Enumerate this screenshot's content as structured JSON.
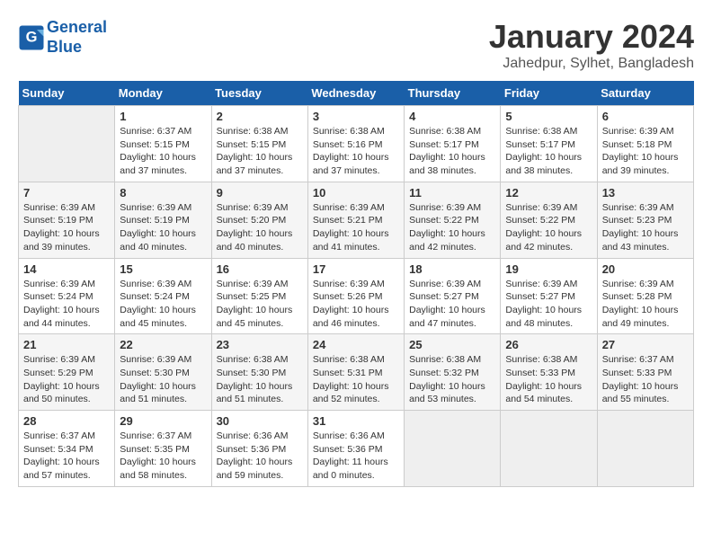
{
  "logo": {
    "line1": "General",
    "line2": "Blue"
  },
  "title": "January 2024",
  "subtitle": "Jahedpur, Sylhet, Bangladesh",
  "days_of_week": [
    "Sunday",
    "Monday",
    "Tuesday",
    "Wednesday",
    "Thursday",
    "Friday",
    "Saturday"
  ],
  "weeks": [
    [
      {
        "day": "",
        "info": ""
      },
      {
        "day": "1",
        "info": "Sunrise: 6:37 AM\nSunset: 5:15 PM\nDaylight: 10 hours\nand 37 minutes."
      },
      {
        "day": "2",
        "info": "Sunrise: 6:38 AM\nSunset: 5:15 PM\nDaylight: 10 hours\nand 37 minutes."
      },
      {
        "day": "3",
        "info": "Sunrise: 6:38 AM\nSunset: 5:16 PM\nDaylight: 10 hours\nand 37 minutes."
      },
      {
        "day": "4",
        "info": "Sunrise: 6:38 AM\nSunset: 5:17 PM\nDaylight: 10 hours\nand 38 minutes."
      },
      {
        "day": "5",
        "info": "Sunrise: 6:38 AM\nSunset: 5:17 PM\nDaylight: 10 hours\nand 38 minutes."
      },
      {
        "day": "6",
        "info": "Sunrise: 6:39 AM\nSunset: 5:18 PM\nDaylight: 10 hours\nand 39 minutes."
      }
    ],
    [
      {
        "day": "7",
        "info": "Sunrise: 6:39 AM\nSunset: 5:19 PM\nDaylight: 10 hours\nand 39 minutes."
      },
      {
        "day": "8",
        "info": "Sunrise: 6:39 AM\nSunset: 5:19 PM\nDaylight: 10 hours\nand 40 minutes."
      },
      {
        "day": "9",
        "info": "Sunrise: 6:39 AM\nSunset: 5:20 PM\nDaylight: 10 hours\nand 40 minutes."
      },
      {
        "day": "10",
        "info": "Sunrise: 6:39 AM\nSunset: 5:21 PM\nDaylight: 10 hours\nand 41 minutes."
      },
      {
        "day": "11",
        "info": "Sunrise: 6:39 AM\nSunset: 5:22 PM\nDaylight: 10 hours\nand 42 minutes."
      },
      {
        "day": "12",
        "info": "Sunrise: 6:39 AM\nSunset: 5:22 PM\nDaylight: 10 hours\nand 42 minutes."
      },
      {
        "day": "13",
        "info": "Sunrise: 6:39 AM\nSunset: 5:23 PM\nDaylight: 10 hours\nand 43 minutes."
      }
    ],
    [
      {
        "day": "14",
        "info": "Sunrise: 6:39 AM\nSunset: 5:24 PM\nDaylight: 10 hours\nand 44 minutes."
      },
      {
        "day": "15",
        "info": "Sunrise: 6:39 AM\nSunset: 5:24 PM\nDaylight: 10 hours\nand 45 minutes."
      },
      {
        "day": "16",
        "info": "Sunrise: 6:39 AM\nSunset: 5:25 PM\nDaylight: 10 hours\nand 45 minutes."
      },
      {
        "day": "17",
        "info": "Sunrise: 6:39 AM\nSunset: 5:26 PM\nDaylight: 10 hours\nand 46 minutes."
      },
      {
        "day": "18",
        "info": "Sunrise: 6:39 AM\nSunset: 5:27 PM\nDaylight: 10 hours\nand 47 minutes."
      },
      {
        "day": "19",
        "info": "Sunrise: 6:39 AM\nSunset: 5:27 PM\nDaylight: 10 hours\nand 48 minutes."
      },
      {
        "day": "20",
        "info": "Sunrise: 6:39 AM\nSunset: 5:28 PM\nDaylight: 10 hours\nand 49 minutes."
      }
    ],
    [
      {
        "day": "21",
        "info": "Sunrise: 6:39 AM\nSunset: 5:29 PM\nDaylight: 10 hours\nand 50 minutes."
      },
      {
        "day": "22",
        "info": "Sunrise: 6:39 AM\nSunset: 5:30 PM\nDaylight: 10 hours\nand 51 minutes."
      },
      {
        "day": "23",
        "info": "Sunrise: 6:38 AM\nSunset: 5:30 PM\nDaylight: 10 hours\nand 51 minutes."
      },
      {
        "day": "24",
        "info": "Sunrise: 6:38 AM\nSunset: 5:31 PM\nDaylight: 10 hours\nand 52 minutes."
      },
      {
        "day": "25",
        "info": "Sunrise: 6:38 AM\nSunset: 5:32 PM\nDaylight: 10 hours\nand 53 minutes."
      },
      {
        "day": "26",
        "info": "Sunrise: 6:38 AM\nSunset: 5:33 PM\nDaylight: 10 hours\nand 54 minutes."
      },
      {
        "day": "27",
        "info": "Sunrise: 6:37 AM\nSunset: 5:33 PM\nDaylight: 10 hours\nand 55 minutes."
      }
    ],
    [
      {
        "day": "28",
        "info": "Sunrise: 6:37 AM\nSunset: 5:34 PM\nDaylight: 10 hours\nand 57 minutes."
      },
      {
        "day": "29",
        "info": "Sunrise: 6:37 AM\nSunset: 5:35 PM\nDaylight: 10 hours\nand 58 minutes."
      },
      {
        "day": "30",
        "info": "Sunrise: 6:36 AM\nSunset: 5:36 PM\nDaylight: 10 hours\nand 59 minutes."
      },
      {
        "day": "31",
        "info": "Sunrise: 6:36 AM\nSunset: 5:36 PM\nDaylight: 11 hours\nand 0 minutes."
      },
      {
        "day": "",
        "info": ""
      },
      {
        "day": "",
        "info": ""
      },
      {
        "day": "",
        "info": ""
      }
    ]
  ]
}
